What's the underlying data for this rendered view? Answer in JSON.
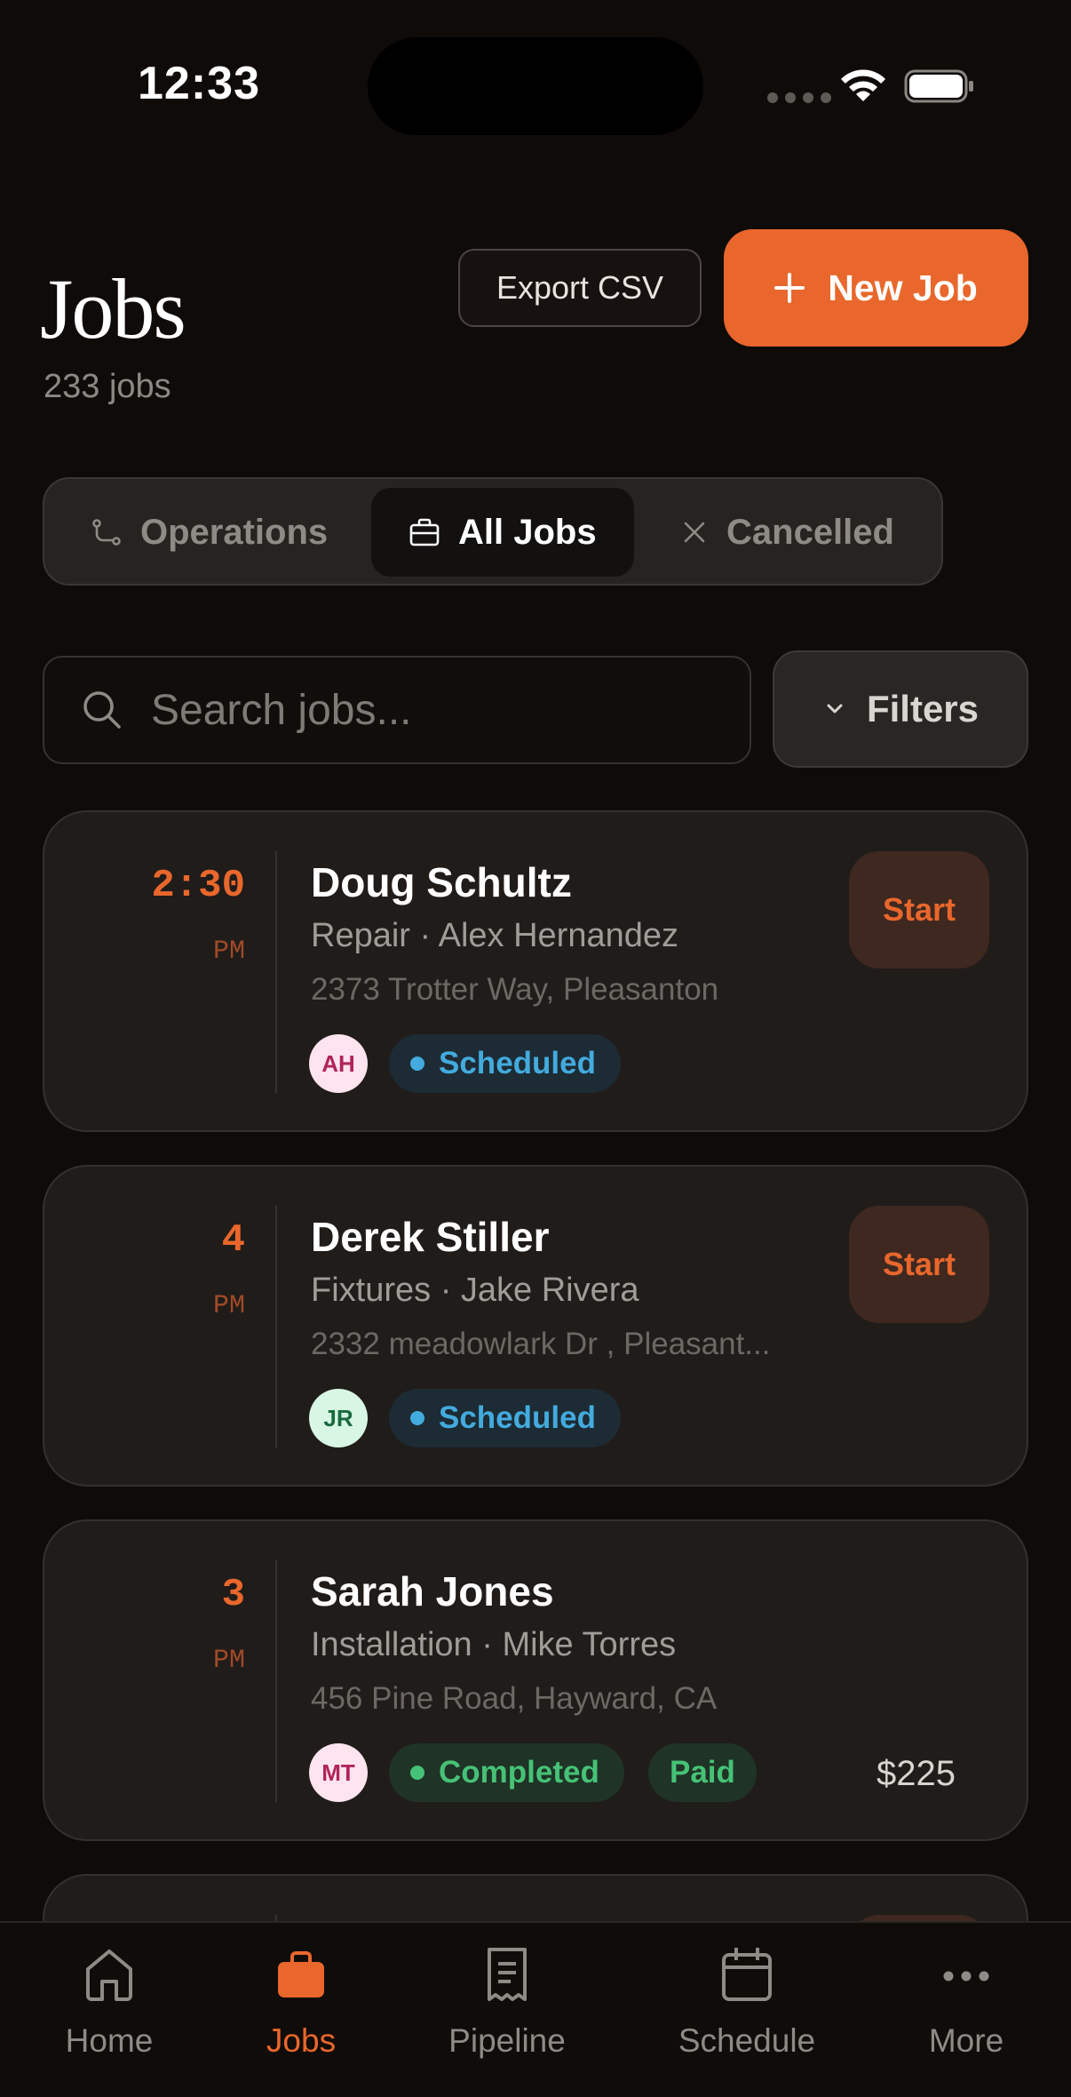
{
  "status_bar": {
    "time": "12:33"
  },
  "header": {
    "title": "Jobs",
    "count": "233 jobs",
    "export_label": "Export CSV",
    "new_job_label": "New Job"
  },
  "tabs": [
    {
      "label": "Operations",
      "icon": "route-icon",
      "active": false
    },
    {
      "label": "All Jobs",
      "icon": "briefcase-icon",
      "active": true
    },
    {
      "label": "Cancelled",
      "icon": "x-icon",
      "active": false
    }
  ],
  "search": {
    "placeholder": "Search jobs...",
    "value": ""
  },
  "filters_label": "Filters",
  "jobs": [
    {
      "time": "2:30",
      "ampm": "PM",
      "customer": "Doug Schultz",
      "meta": "Repair · Alex Hernandez",
      "address": "2373 Trotter Way, Pleasanton",
      "initials": "AH",
      "status": "Scheduled",
      "action": "Start"
    },
    {
      "time": "4",
      "ampm": "PM",
      "customer": "Derek Stiller",
      "meta": "Fixtures · Jake Rivera",
      "address": "2332 meadowlark Dr , Pleasant...",
      "initials": "JR",
      "status": "Scheduled",
      "action": "Start"
    },
    {
      "time": "3",
      "ampm": "PM",
      "customer": "Sarah Jones",
      "meta": "Installation · Mike Torres",
      "address": "456 Pine Road, Hayward, CA",
      "initials": "MT",
      "status": "Completed",
      "payment": "Paid",
      "amount": "$225"
    }
  ],
  "nav": [
    {
      "label": "Home",
      "icon": "home-icon"
    },
    {
      "label": "Jobs",
      "icon": "briefcase-icon",
      "active": true
    },
    {
      "label": "Pipeline",
      "icon": "receipt-icon"
    },
    {
      "label": "Schedule",
      "icon": "calendar-icon"
    },
    {
      "label": "More",
      "icon": "more-icon"
    }
  ],
  "colors": {
    "accent": "#e9672c",
    "background": "#0f0b09",
    "card": "#201c1a",
    "scheduled": "#43abdd",
    "completed": "#46c276"
  }
}
